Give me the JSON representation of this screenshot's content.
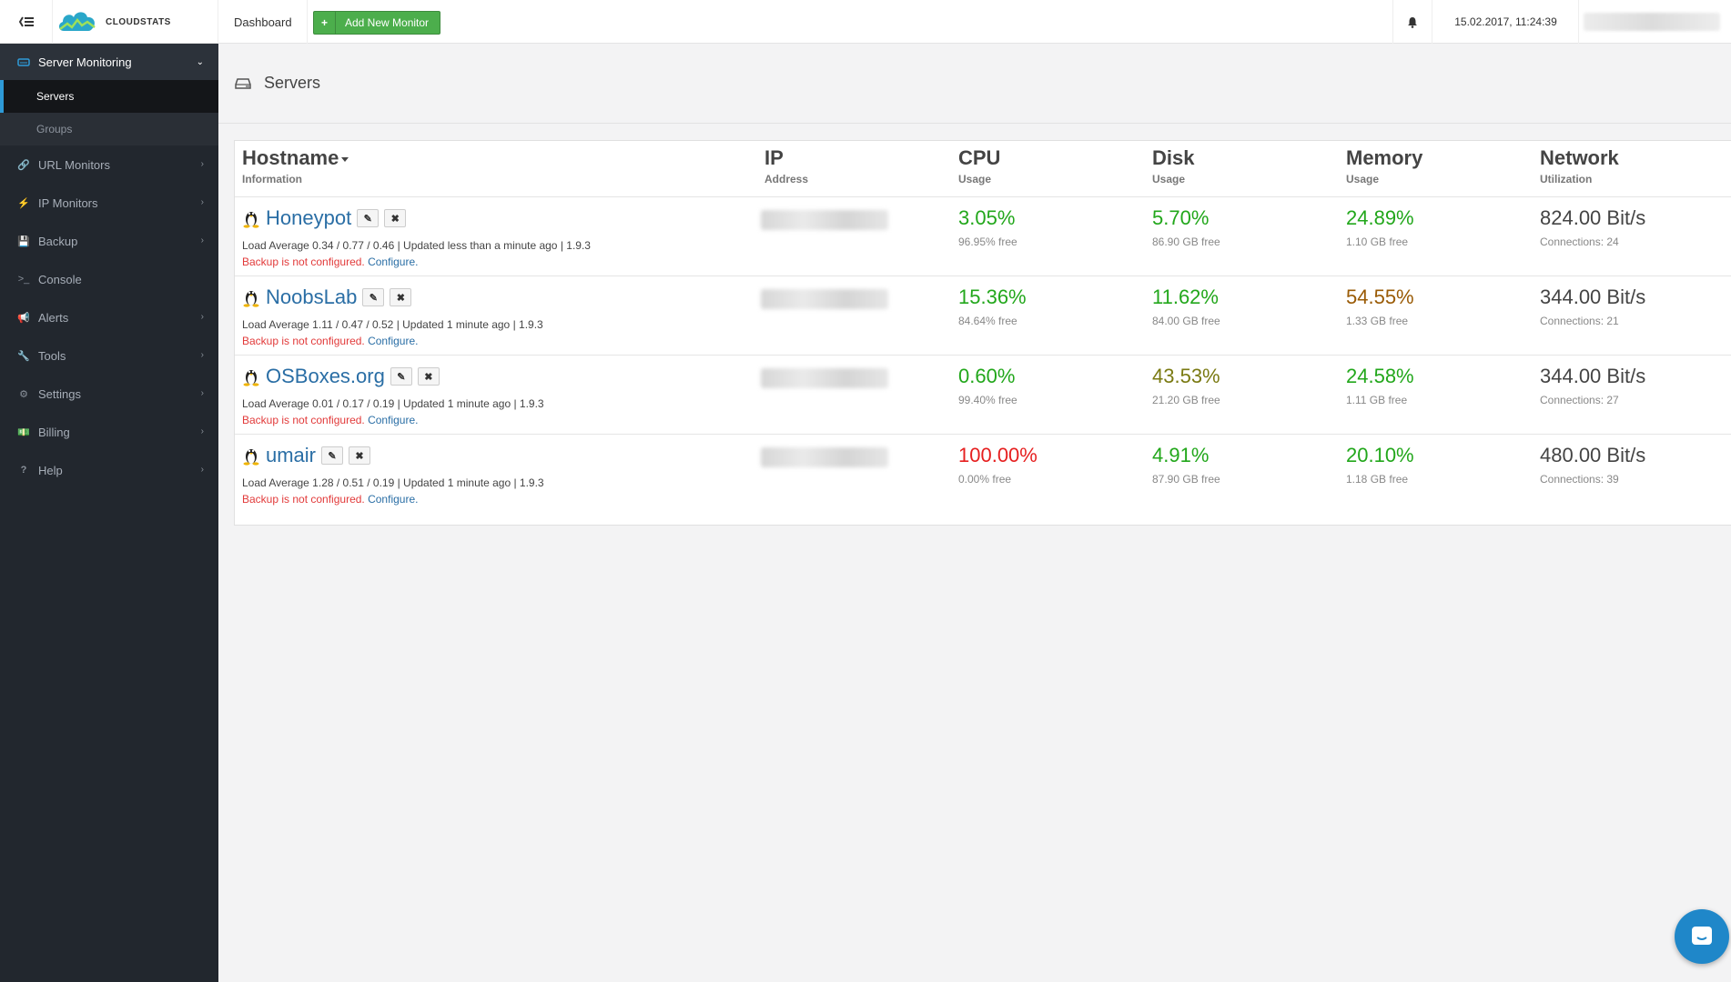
{
  "topbar": {
    "brand": "CLOUDSTATS",
    "dashboard_label": "Dashboard",
    "add_monitor_label": "Add New Monitor",
    "datetime": "15.02.2017, 11:24:39"
  },
  "sidebar": {
    "active_section": "Server Monitoring",
    "sub_items": [
      "Servers",
      "Groups"
    ],
    "items": [
      {
        "label": "URL Monitors",
        "icon": "link-icon"
      },
      {
        "label": "IP Monitors",
        "icon": "bolt-icon"
      },
      {
        "label": "Backup",
        "icon": "backup-icon"
      },
      {
        "label": "Console",
        "icon": "terminal-icon"
      },
      {
        "label": "Alerts",
        "icon": "megaphone-icon"
      },
      {
        "label": "Tools",
        "icon": "wrench-icon"
      },
      {
        "label": "Settings",
        "icon": "gears-icon"
      },
      {
        "label": "Billing",
        "icon": "money-icon"
      },
      {
        "label": "Help",
        "icon": "question-icon"
      }
    ]
  },
  "page": {
    "title": "Servers"
  },
  "table": {
    "headers": [
      {
        "title": "Hostname",
        "sub": "Information"
      },
      {
        "title": "IP",
        "sub": "Address"
      },
      {
        "title": "CPU",
        "sub": "Usage"
      },
      {
        "title": "Disk",
        "sub": "Usage"
      },
      {
        "title": "Memory",
        "sub": "Usage"
      },
      {
        "title": "Network",
        "sub": "Utilization"
      }
    ],
    "backup_warning": "Backup is not configured.",
    "configure_label": "Configure.",
    "rows": [
      {
        "hostname": "Honeypot",
        "info": "Load Average 0.34 / 0.77 / 0.46 | Updated less than a minute ago | 1.9.3",
        "cpu": "3.05%",
        "cpu_free": "96.95% free",
        "disk": "5.70%",
        "disk_free": "86.90 GB free",
        "memory": "24.89%",
        "memory_free": "1.10 GB free",
        "network": "824.00 Bit/s",
        "connections": "Connections: 24"
      },
      {
        "hostname": "NoobsLab",
        "info": "Load Average 1.11 / 0.47 / 0.52 | Updated 1 minute ago | 1.9.3",
        "cpu": "15.36%",
        "cpu_free": "84.64% free",
        "disk": "11.62%",
        "disk_free": "84.00 GB free",
        "memory": "54.55%",
        "memory_free": "1.33 GB free",
        "network": "344.00 Bit/s",
        "connections": "Connections: 21"
      },
      {
        "hostname": "OSBoxes.org",
        "info": "Load Average 0.01 / 0.17 / 0.19 | Updated 1 minute ago | 1.9.3",
        "cpu": "0.60%",
        "cpu_free": "99.40% free",
        "disk": "43.53%",
        "disk_free": "21.20 GB free",
        "memory": "24.58%",
        "memory_free": "1.11 GB free",
        "network": "344.00 Bit/s",
        "connections": "Connections: 27"
      },
      {
        "hostname": "umair",
        "info": "Load Average 1.28 / 0.51 / 0.19 | Updated 1 minute ago | 1.9.3",
        "cpu": "100.00%",
        "cpu_free": "0.00% free",
        "disk": "4.91%",
        "disk_free": "87.90 GB free",
        "memory": "20.10%",
        "memory_free": "1.18 GB free",
        "network": "480.00 Bit/s",
        "connections": "Connections: 39"
      }
    ]
  },
  "colors": {
    "sidebar_bg": "#22272e",
    "accent_blue": "#2e9ad7",
    "add_button_green": "#4cae4c",
    "metric_green": "#22a71b",
    "metric_olive": "#7a7a12",
    "metric_brown": "#9a5b06",
    "metric_red": "#e61f1f",
    "warning_red": "#e23a3a",
    "link_blue": "#2a6ea5"
  }
}
